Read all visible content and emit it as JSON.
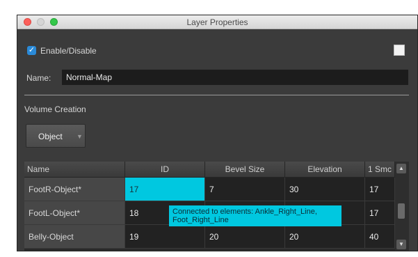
{
  "window": {
    "title": "Layer Properties"
  },
  "enable": {
    "label": "Enable/Disable",
    "checked": true
  },
  "name_field": {
    "label": "Name:",
    "value": "Normal-Map"
  },
  "volume": {
    "section_label": "Volume Creation",
    "dropdown_value": "Object"
  },
  "table": {
    "columns": [
      "Name",
      "ID",
      "Bevel Size",
      "Elevation",
      "1 Smc"
    ],
    "rows": [
      {
        "name": "FootR-Object*",
        "id": "17",
        "bevel": "7",
        "elevation": "30",
        "smooth": "17"
      },
      {
        "name": "FootL-Object*",
        "id": "18",
        "bevel": "",
        "elevation": "",
        "smooth": "17"
      },
      {
        "name": "Belly-Object",
        "id": "19",
        "bevel": "20",
        "elevation": "20",
        "smooth": "40"
      }
    ],
    "selected_cell": {
      "row": 0,
      "column": "ID"
    }
  },
  "tooltip": {
    "line1": "Connected to elements: Ankle_Right_Line,",
    "line2": "Foot_Right_Line"
  },
  "colors": {
    "selection": "#00c8e0",
    "checkbox": "#2a8ad8",
    "panel": "#3b3b3b"
  }
}
